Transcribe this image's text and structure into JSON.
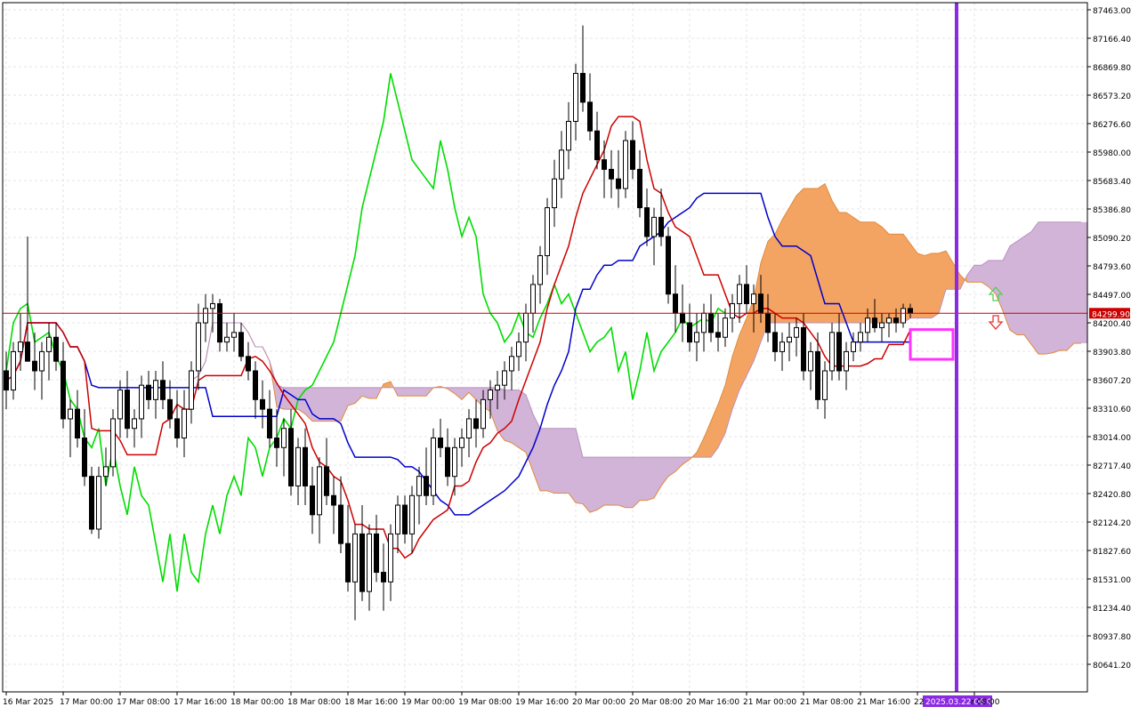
{
  "chart_data": {
    "type": "candlestick",
    "title": "",
    "xlabel": "",
    "ylabel": "",
    "ylim": [
      80400.0,
      87500.0
    ],
    "grid": true,
    "y_ticks": [
      "87463.00",
      "87166.40",
      "86869.80",
      "86573.20",
      "86276.60",
      "85980.00",
      "85683.40",
      "85386.80",
      "85090.20",
      "84793.60",
      "84497.00",
      "84200.40",
      "83903.80",
      "83607.20",
      "83310.60",
      "83014.00",
      "82717.40",
      "82420.80",
      "82124.20",
      "81827.60",
      "81531.00",
      "81234.40",
      "80937.80",
      "80641.20"
    ],
    "x_ticks": [
      {
        "label": "16 Mar 2025",
        "idx": 0
      },
      {
        "label": "17 Mar 00:00",
        "idx": 8
      },
      {
        "label": "17 Mar 08:00",
        "idx": 16
      },
      {
        "label": "17 Mar 16:00",
        "idx": 24
      },
      {
        "label": "18 Mar 00:00",
        "idx": 32
      },
      {
        "label": "18 Mar 08:00",
        "idx": 40
      },
      {
        "label": "18 Mar 16:00",
        "idx": 48
      },
      {
        "label": "19 Mar 00:00",
        "idx": 56
      },
      {
        "label": "19 Mar 08:00",
        "idx": 64
      },
      {
        "label": "19 Mar 16:00",
        "idx": 72
      },
      {
        "label": "20 Mar 00:00",
        "idx": 80
      },
      {
        "label": "20 Mar 08:00",
        "idx": 88
      },
      {
        "label": "20 Mar 16:00",
        "idx": 96
      },
      {
        "label": "21 Mar 00:00",
        "idx": 104
      },
      {
        "label": "21 Mar 08:00",
        "idx": 112
      },
      {
        "label": "21 Mar 16:00",
        "idx": 120
      },
      {
        "label": "22",
        "idx": 128
      },
      {
        "label": "r 08:00",
        "idx": 136
      }
    ],
    "current_price": {
      "label": "84299.90",
      "value": 84299.9,
      "color": "#cc0000"
    },
    "cursor": {
      "label": "2025.03.22 06:00",
      "idx": 133.5,
      "color": "#8a2be2"
    },
    "candles": [
      [
        83700,
        83900,
        83300,
        83500
      ],
      [
        83500,
        84000,
        83400,
        83900
      ],
      [
        83900,
        84300,
        83700,
        84000
      ],
      [
        84000,
        85100,
        83800,
        83800
      ],
      [
        83800,
        84100,
        83500,
        83700
      ],
      [
        83700,
        84000,
        83400,
        83900
      ],
      [
        83900,
        84200,
        83600,
        84050
      ],
      [
        84050,
        84200,
        83700,
        83800
      ],
      [
        83800,
        84000,
        83100,
        83200
      ],
      [
        83200,
        83400,
        82800,
        83300
      ],
      [
        83300,
        83500,
        82900,
        83000
      ],
      [
        83000,
        83300,
        82500,
        82600
      ],
      [
        82600,
        82700,
        82000,
        82050
      ],
      [
        82050,
        82700,
        81950,
        82600
      ],
      [
        82600,
        82900,
        82500,
        82700
      ],
      [
        82700,
        83300,
        82600,
        83200
      ],
      [
        83200,
        83600,
        83000,
        83500
      ],
      [
        83500,
        83700,
        83000,
        83100
      ],
      [
        83100,
        83300,
        82900,
        83200
      ],
      [
        83200,
        83650,
        83000,
        83550
      ],
      [
        83550,
        83700,
        83300,
        83400
      ],
      [
        83400,
        83700,
        83200,
        83600
      ],
      [
        83600,
        83800,
        83300,
        83400
      ],
      [
        83400,
        83600,
        83100,
        83200
      ],
      [
        83200,
        83500,
        82900,
        83000
      ],
      [
        83000,
        83500,
        82800,
        83300
      ],
      [
        83300,
        83800,
        83150,
        83700
      ],
      [
        83700,
        84400,
        83500,
        84200
      ],
      [
        84200,
        84500,
        84000,
        84350
      ],
      [
        84350,
        84500,
        84100,
        84400
      ],
      [
        84400,
        84450,
        83900,
        84000
      ],
      [
        84000,
        84200,
        83900,
        84050
      ],
      [
        84050,
        84300,
        83900,
        84100
      ],
      [
        84100,
        84200,
        83800,
        83850
      ],
      [
        83850,
        84000,
        83600,
        83700
      ],
      [
        83700,
        83800,
        83200,
        83400
      ],
      [
        83400,
        83600,
        83100,
        83300
      ],
      [
        83300,
        83500,
        82900,
        83000
      ],
      [
        83000,
        83300,
        82700,
        82900
      ],
      [
        82900,
        83200,
        82600,
        83100
      ],
      [
        83100,
        83300,
        82400,
        82500
      ],
      [
        82500,
        83000,
        82300,
        82900
      ],
      [
        82900,
        83100,
        82300,
        82500
      ],
      [
        82500,
        82700,
        82000,
        82200
      ],
      [
        82200,
        82800,
        81900,
        82700
      ],
      [
        82700,
        83000,
        82300,
        82400
      ],
      [
        82400,
        82600,
        82000,
        82300
      ],
      [
        82300,
        82600,
        81800,
        81900
      ],
      [
        81900,
        82300,
        81400,
        81500
      ],
      [
        81500,
        82100,
        81100,
        82000
      ],
      [
        82000,
        82300,
        81300,
        81400
      ],
      [
        81400,
        82100,
        81200,
        82000
      ],
      [
        82000,
        82200,
        81500,
        81600
      ],
      [
        81600,
        81900,
        81200,
        81500
      ],
      [
        81500,
        82100,
        81300,
        82000
      ],
      [
        82000,
        82400,
        81800,
        82300
      ],
      [
        82300,
        82400,
        81900,
        82000
      ],
      [
        82000,
        82500,
        81800,
        82400
      ],
      [
        82400,
        82700,
        82100,
        82600
      ],
      [
        82600,
        82900,
        82300,
        82400
      ],
      [
        82400,
        83100,
        82300,
        83000
      ],
      [
        83000,
        83200,
        82800,
        82900
      ],
      [
        82900,
        83100,
        82500,
        82600
      ],
      [
        82600,
        83000,
        82400,
        82900
      ],
      [
        82900,
        83100,
        82700,
        83000
      ],
      [
        83000,
        83300,
        82800,
        83200
      ],
      [
        83200,
        83400,
        82900,
        83100
      ],
      [
        83100,
        83500,
        83000,
        83400
      ],
      [
        83400,
        83600,
        83200,
        83500
      ],
      [
        83500,
        83700,
        83300,
        83550
      ],
      [
        83550,
        83800,
        83400,
        83700
      ],
      [
        83700,
        83950,
        83500,
        83850
      ],
      [
        83850,
        84100,
        83700,
        84000
      ],
      [
        84000,
        84400,
        83800,
        84300
      ],
      [
        84300,
        84700,
        84100,
        84600
      ],
      [
        84600,
        85000,
        84400,
        84900
      ],
      [
        84900,
        85500,
        84700,
        85400
      ],
      [
        85400,
        85900,
        85200,
        85700
      ],
      [
        85700,
        86200,
        85500,
        86000
      ],
      [
        86000,
        86500,
        85800,
        86300
      ],
      [
        86300,
        86900,
        86100,
        86800
      ],
      [
        86800,
        87300,
        86400,
        86500
      ],
      [
        86500,
        86800,
        86100,
        86200
      ],
      [
        86200,
        86400,
        85800,
        85900
      ],
      [
        85900,
        86100,
        85500,
        85800
      ],
      [
        85800,
        86000,
        85500,
        85700
      ],
      [
        85700,
        86000,
        85400,
        85600
      ],
      [
        85600,
        86200,
        85500,
        86100
      ],
      [
        86100,
        86300,
        85700,
        85800
      ],
      [
        85800,
        86000,
        85300,
        85400
      ],
      [
        85400,
        85600,
        85000,
        85100
      ],
      [
        85100,
        85400,
        84800,
        85300
      ],
      [
        85300,
        85600,
        85000,
        85100
      ],
      [
        85100,
        85200,
        84400,
        84500
      ],
      [
        84500,
        84800,
        84100,
        84300
      ],
      [
        84300,
        84600,
        84000,
        84200
      ],
      [
        84200,
        84400,
        83900,
        84000
      ],
      [
        84000,
        84300,
        83800,
        84100
      ],
      [
        84100,
        84400,
        83900,
        84300
      ],
      [
        84300,
        84500,
        84000,
        84100
      ],
      [
        84100,
        84300,
        83900,
        84050
      ],
      [
        84050,
        84350,
        83950,
        84250
      ],
      [
        84250,
        84500,
        84100,
        84400
      ],
      [
        84400,
        84700,
        84200,
        84600
      ],
      [
        84600,
        84800,
        84300,
        84400
      ],
      [
        84400,
        84600,
        84100,
        84500
      ],
      [
        84500,
        84700,
        84200,
        84300
      ],
      [
        84300,
        84500,
        84000,
        84100
      ],
      [
        84100,
        84300,
        83800,
        83900
      ],
      [
        83900,
        84100,
        83700,
        84000
      ],
      [
        84000,
        84200,
        83800,
        84050
      ],
      [
        84050,
        84250,
        83850,
        84150
      ],
      [
        84150,
        84300,
        83600,
        83700
      ],
      [
        83700,
        84000,
        83500,
        83900
      ],
      [
        83900,
        84100,
        83300,
        83400
      ],
      [
        83400,
        83800,
        83200,
        83700
      ],
      [
        83700,
        84200,
        83600,
        84100
      ],
      [
        84100,
        84300,
        83600,
        83700
      ],
      [
        83700,
        84000,
        83500,
        83900
      ],
      [
        83900,
        84100,
        83800,
        84000
      ],
      [
        84000,
        84200,
        83900,
        84100
      ],
      [
        84100,
        84350,
        84000,
        84250
      ],
      [
        84250,
        84450,
        84100,
        84150
      ],
      [
        84150,
        84300,
        84000,
        84200
      ],
      [
        84200,
        84300,
        84050,
        84250
      ],
      [
        84250,
        84350,
        84100,
        84200
      ],
      [
        84200,
        84400,
        84150,
        84350
      ],
      [
        84350,
        84400,
        84250,
        84300
      ]
    ],
    "ichimoku": {
      "tenkan_sen_color": "#cc0000",
      "kijun_sen_color": "#0000cc",
      "chikou_span_color": "#00dd00",
      "kumo_bull_color": "#f4a462",
      "kumo_bear_color": "#d2b4d8"
    },
    "annotations": {
      "up_arrow_color": "#55cc55",
      "down_arrow_color": "#ee3333",
      "box_color": "#ff33ff"
    }
  }
}
